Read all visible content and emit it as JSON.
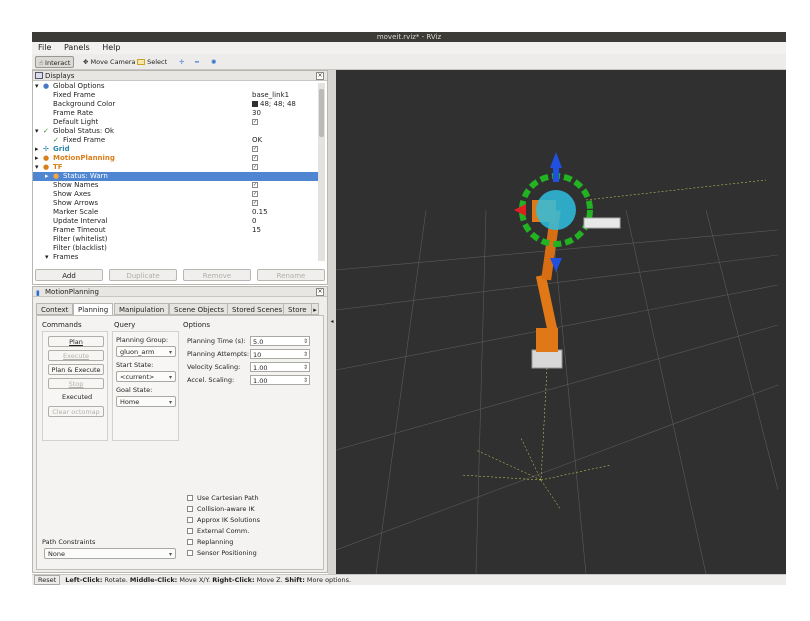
{
  "window": {
    "title": "moveit.rviz* - RViz"
  },
  "menu": [
    "File",
    "Panels",
    "Help"
  ],
  "toolbar": {
    "interact": "Interact",
    "move_camera": "Move Camera",
    "select": "Select"
  },
  "displays": {
    "title": "Displays",
    "rows": [
      {
        "label": "Global Options",
        "value": ""
      },
      {
        "label": "Fixed Frame",
        "value": "base_link1"
      },
      {
        "label": "Background Color",
        "value": "48; 48; 48"
      },
      {
        "label": "Frame Rate",
        "value": "30"
      },
      {
        "label": "Default Light",
        "value": "✓"
      },
      {
        "label": "Global Status: Ok",
        "value": ""
      },
      {
        "label": "Fixed Frame",
        "value": "OK"
      },
      {
        "label": "Grid",
        "value": "✓"
      },
      {
        "label": "MotionPlanning",
        "value": "✓"
      },
      {
        "label": "TF",
        "value": "✓"
      },
      {
        "label": "Status: Warn",
        "value": ""
      },
      {
        "label": "Show Names",
        "value": "✓"
      },
      {
        "label": "Show Axes",
        "value": "✓"
      },
      {
        "label": "Show Arrows",
        "value": "✓"
      },
      {
        "label": "Marker Scale",
        "value": "0.15"
      },
      {
        "label": "Update Interval",
        "value": "0"
      },
      {
        "label": "Frame Timeout",
        "value": "15"
      },
      {
        "label": "Filter (whitelist)",
        "value": ""
      },
      {
        "label": "Filter (blacklist)",
        "value": ""
      },
      {
        "label": "Frames",
        "value": ""
      }
    ],
    "buttons": {
      "add": "Add",
      "duplicate": "Duplicate",
      "remove": "Remove",
      "rename": "Rename"
    }
  },
  "motion": {
    "title": "MotionPlanning",
    "tabs": [
      "Context",
      "Planning",
      "Manipulation",
      "Scene Objects",
      "Stored Scenes",
      "Store"
    ],
    "commands": {
      "heading": "Commands",
      "plan": "Plan",
      "execute": "Execute",
      "plan_execute": "Plan & Execute",
      "stop": "Stop",
      "status": "Executed",
      "clear": "Clear octomap"
    },
    "query": {
      "heading": "Query",
      "group_label": "Planning Group:",
      "group_value": "gluon_arm",
      "start_label": "Start State:",
      "start_value": "<current>",
      "goal_label": "Goal State:",
      "goal_value": "Home"
    },
    "options": {
      "heading": "Options",
      "time_label": "Planning Time (s):",
      "time_value": "5.0",
      "attempts_label": "Planning Attempts:",
      "attempts_value": "10",
      "vel_label": "Velocity Scaling:",
      "vel_value": "1.00",
      "acc_label": "Accel. Scaling:",
      "acc_value": "1.00",
      "checks": [
        "Use Cartesian Path",
        "Collision-aware IK",
        "Approx IK Solutions",
        "External Comm.",
        "Replanning",
        "Sensor Positioning"
      ]
    },
    "path": {
      "heading": "Path Constraints",
      "value": "None"
    }
  },
  "status": {
    "reset": "Reset",
    "left": "Left-Click:",
    "left_txt": " Rotate. ",
    "middle": "Middle-Click:",
    "middle_txt": " Move X/Y. ",
    "right": "Right-Click:",
    "right_txt": " Move Z. ",
    "shift": "Shift:",
    "shift_txt": " More options."
  }
}
